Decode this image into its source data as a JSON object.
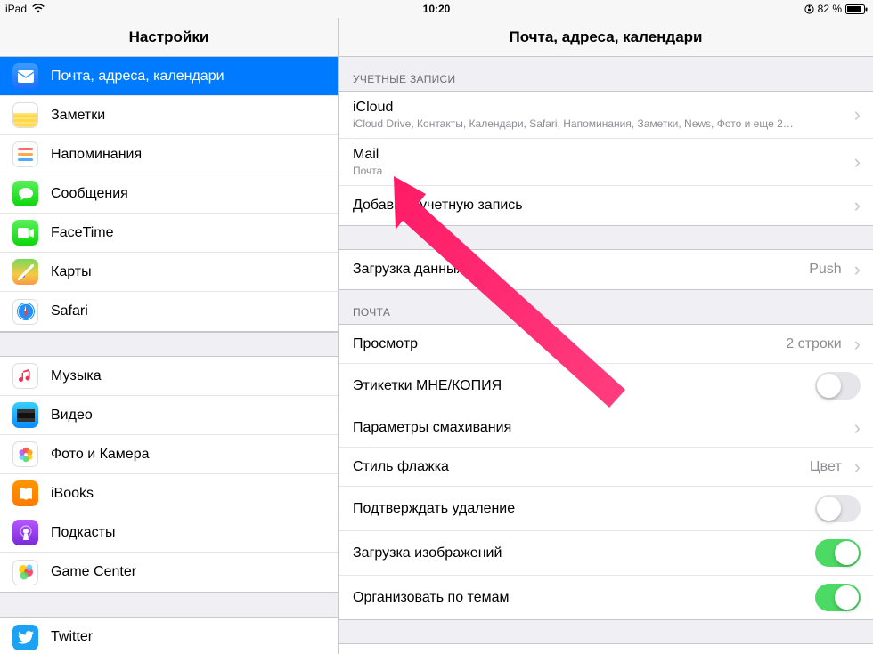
{
  "status": {
    "device": "iPad",
    "time": "10:20",
    "battery_text": "82 %"
  },
  "left": {
    "title": "Настройки",
    "group1": [
      {
        "key": "mail-contacts-calendar",
        "label": "Почта, адреса, календари",
        "icon": "mail-icon",
        "iconClass": "ic-mail",
        "selected": true
      },
      {
        "key": "notes",
        "label": "Заметки",
        "icon": "notes-icon",
        "iconClass": "ic-notes"
      },
      {
        "key": "reminders",
        "label": "Напоминания",
        "icon": "reminders-icon",
        "iconClass": "ic-remind"
      },
      {
        "key": "messages",
        "label": "Сообщения",
        "icon": "messages-icon",
        "iconClass": "ic-msg"
      },
      {
        "key": "facetime",
        "label": "FaceTime",
        "icon": "facetime-icon",
        "iconClass": "ic-ft"
      },
      {
        "key": "maps",
        "label": "Карты",
        "icon": "maps-icon",
        "iconClass": "ic-maps"
      },
      {
        "key": "safari",
        "label": "Safari",
        "icon": "safari-icon",
        "iconClass": "ic-safari"
      }
    ],
    "group2": [
      {
        "key": "music",
        "label": "Музыка",
        "icon": "music-icon",
        "iconClass": "ic-music"
      },
      {
        "key": "videos",
        "label": "Видео",
        "icon": "videos-icon",
        "iconClass": "ic-video"
      },
      {
        "key": "photos",
        "label": "Фото и Камера",
        "icon": "photos-icon",
        "iconClass": "ic-photos"
      },
      {
        "key": "ibooks",
        "label": "iBooks",
        "icon": "ibooks-icon",
        "iconClass": "ic-ibooks"
      },
      {
        "key": "podcasts",
        "label": "Подкасты",
        "icon": "podcasts-icon",
        "iconClass": "ic-pod"
      },
      {
        "key": "gamecenter",
        "label": "Game Center",
        "icon": "gamecenter-icon",
        "iconClass": "ic-gc"
      }
    ],
    "group3": [
      {
        "key": "twitter",
        "label": "Twitter",
        "icon": "twitter-icon",
        "iconClass": "ic-twitter"
      }
    ]
  },
  "right": {
    "title": "Почта, адреса, календари",
    "accounts_header": "УЧЕТНЫЕ ЗАПИСИ",
    "accounts": [
      {
        "key": "icloud",
        "title": "iCloud",
        "subtitle": "iCloud Drive, Контакты, Календари, Safari, Напоминания, Заметки, News, Фото и еще 2…"
      },
      {
        "key": "mail",
        "title": "Mail",
        "subtitle": "Почта"
      },
      {
        "key": "add",
        "title": "Добавить учетную запись",
        "subtitle": ""
      }
    ],
    "fetch": {
      "title": "Загрузка данных",
      "value": "Push"
    },
    "mail_header": "ПОЧТА",
    "mail_rows": [
      {
        "key": "preview",
        "title": "Просмотр",
        "type": "value",
        "value": "2 строки"
      },
      {
        "key": "tocc",
        "title": "Этикетки МНЕ/КОПИЯ",
        "type": "toggle",
        "on": false
      },
      {
        "key": "swipe",
        "title": "Параметры смахивания",
        "type": "chevron"
      },
      {
        "key": "flagstyle",
        "title": "Стиль флажка",
        "type": "value",
        "value": "Цвет"
      },
      {
        "key": "confirmdel",
        "title": "Подтверждать удаление",
        "type": "toggle",
        "on": false
      },
      {
        "key": "loadimg",
        "title": "Загрузка изображений",
        "type": "toggle",
        "on": true
      },
      {
        "key": "thread",
        "title": "Организовать по темам",
        "type": "toggle",
        "on": true
      }
    ]
  }
}
